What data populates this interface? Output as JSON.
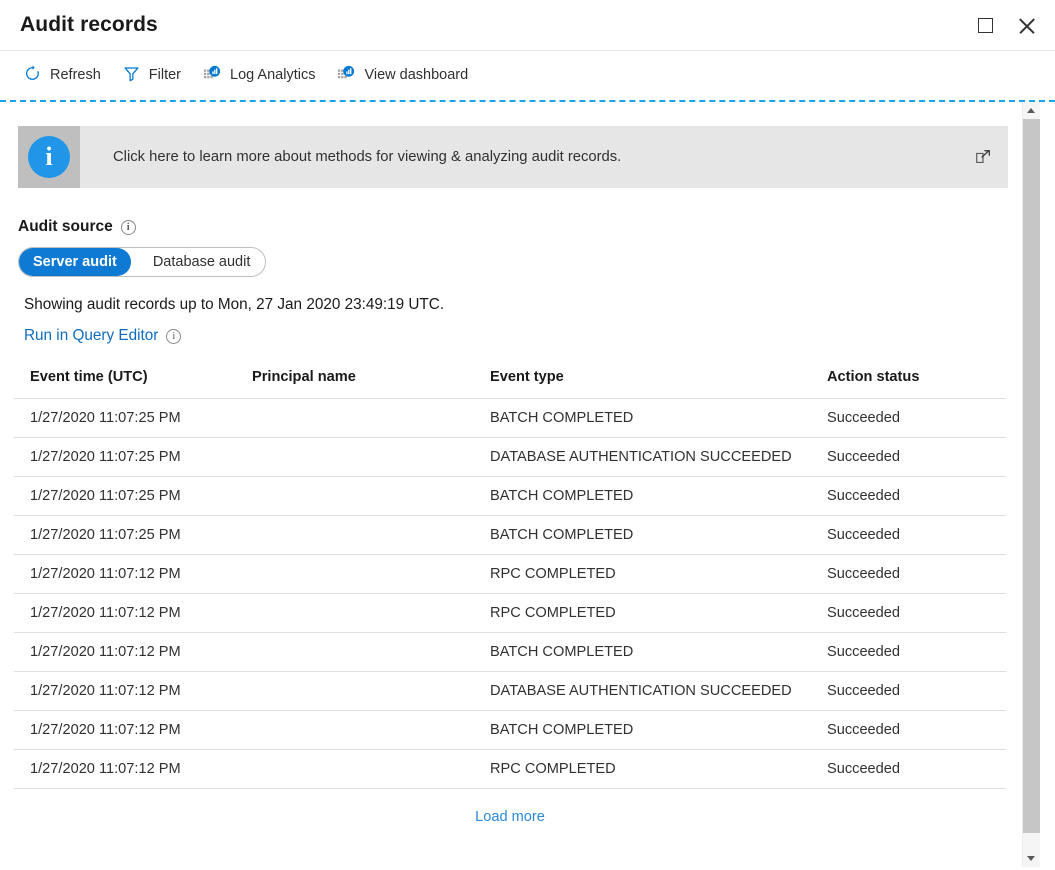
{
  "window": {
    "title": "Audit records",
    "maximize_label": "Maximize",
    "close_label": "Close"
  },
  "toolbar": {
    "items": [
      {
        "label": "Refresh",
        "icon": "refresh-icon"
      },
      {
        "label": "Filter",
        "icon": "filter-icon"
      },
      {
        "label": "Log Analytics",
        "icon": "log-analytics-icon"
      },
      {
        "label": "View dashboard",
        "icon": "view-dashboard-icon"
      }
    ]
  },
  "banner": {
    "text": "Click here to learn more about methods for viewing & analyzing audit records.",
    "icon": "info-icon",
    "glyph": "i",
    "external_link_icon": "external-link-icon"
  },
  "audit_source": {
    "label": "Audit source",
    "info_glyph": "i",
    "options": [
      {
        "label": "Server audit",
        "selected": true
      },
      {
        "label": "Database audit",
        "selected": false
      }
    ]
  },
  "status": {
    "showing_text": "Showing audit records up to Mon, 27 Jan 2020 23:49:19 UTC.",
    "query_editor_link": "Run in Query Editor",
    "query_info_glyph": "i"
  },
  "table": {
    "columns": [
      "Event time (UTC)",
      "Principal name",
      "Event type",
      "Action status"
    ],
    "rows": [
      [
        "1/27/2020 11:07:25 PM",
        "",
        "BATCH COMPLETED",
        "Succeeded"
      ],
      [
        "1/27/2020 11:07:25 PM",
        "",
        "DATABASE AUTHENTICATION SUCCEEDED",
        "Succeeded"
      ],
      [
        "1/27/2020 11:07:25 PM",
        "",
        "BATCH COMPLETED",
        "Succeeded"
      ],
      [
        "1/27/2020 11:07:25 PM",
        "",
        "BATCH COMPLETED",
        "Succeeded"
      ],
      [
        "1/27/2020 11:07:12 PM",
        "",
        "RPC COMPLETED",
        "Succeeded"
      ],
      [
        "1/27/2020 11:07:12 PM",
        "",
        "RPC COMPLETED",
        "Succeeded"
      ],
      [
        "1/27/2020 11:07:12 PM",
        "",
        "BATCH COMPLETED",
        "Succeeded"
      ],
      [
        "1/27/2020 11:07:12 PM",
        "",
        "DATABASE AUTHENTICATION SUCCEEDED",
        "Succeeded"
      ],
      [
        "1/27/2020 11:07:12 PM",
        "",
        "BATCH COMPLETED",
        "Succeeded"
      ],
      [
        "1/27/2020 11:07:12 PM",
        "",
        "RPC COMPLETED",
        "Succeeded"
      ]
    ],
    "load_more_label": "Load more"
  },
  "colors": {
    "accent": "#0078d4",
    "link": "#0f6cbd",
    "load_more_link": "#2b88d8",
    "focus_dash": "#1aa3e8",
    "banner_bg": "#e6e6e6",
    "banner_icon_bg": "#bfbfbf",
    "info_blue": "#2196e8",
    "toggle_active_bg": "#0e7ad4",
    "row_border": "#e1dfdd"
  }
}
